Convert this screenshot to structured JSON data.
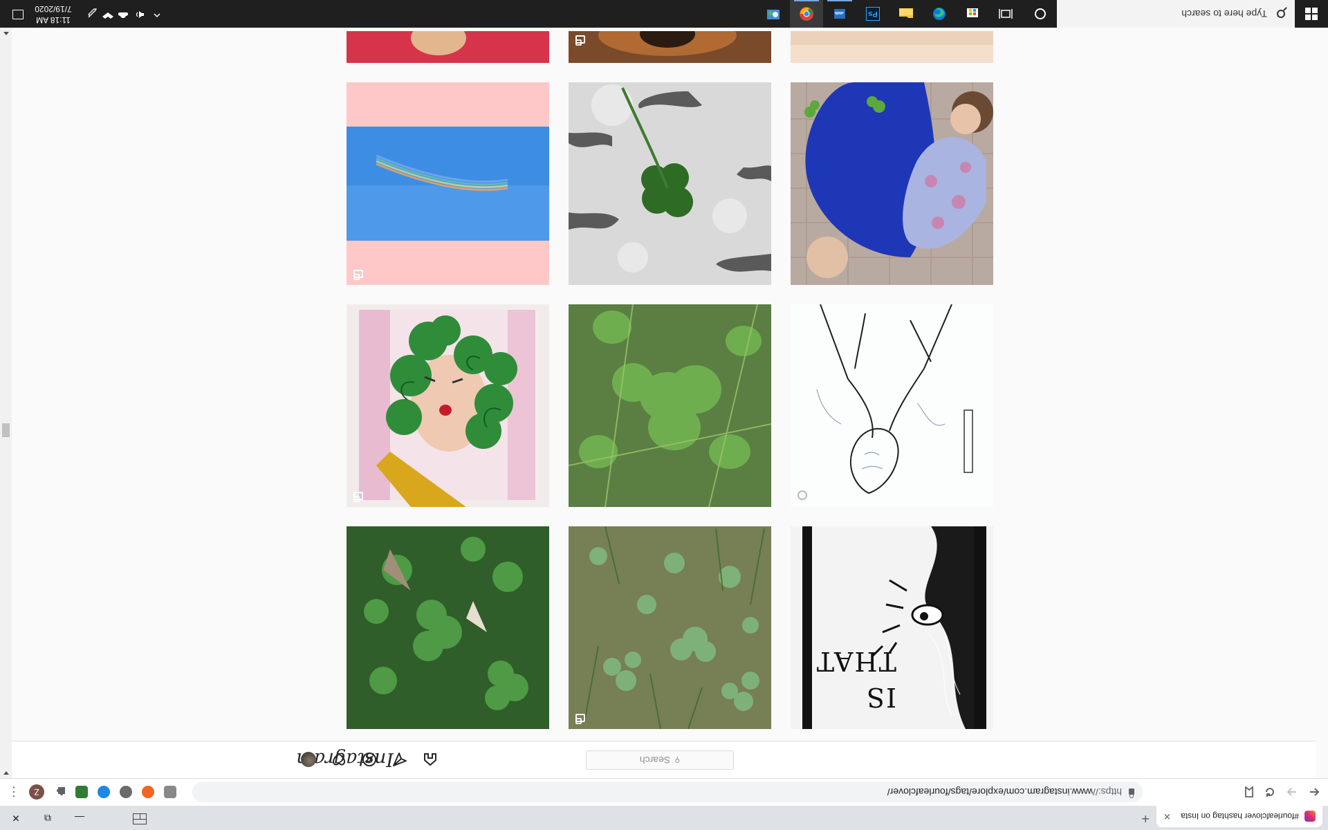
{
  "browser": {
    "tab_title": "#fourleafclover hashtag on Insta",
    "new_tab_label": "+",
    "url_scheme": "https://",
    "url_rest": "www.instagram.com/explore/tags/fourleafclover/",
    "profile_initial": "Z",
    "menu_label": "⋮",
    "close_label": "✕",
    "minimize_label": "—",
    "restore_label": "⧉"
  },
  "instagram": {
    "logo": "Instagram",
    "search_placeholder": "Search",
    "search_icon_glyph": "⚲"
  },
  "taskbar": {
    "search_placeholder": "Type here to search",
    "time": "11:18 AM",
    "date": "7/19/2020",
    "apps": [
      "cortana-icon",
      "task-view-icon",
      "microsoft-store-icon",
      "edge-icon",
      "file-explorer-icon",
      "photoshop-icon",
      "onedrive-icon",
      "chrome-icon",
      "control-panel-icon"
    ],
    "photoshop_label": "Ps"
  },
  "posts": [
    {
      "id": "post-partial-1",
      "badge": "none"
    },
    {
      "id": "post-partial-2",
      "badge": "multi"
    },
    {
      "id": "post-partial-3",
      "badge": "none"
    },
    {
      "id": "post-kids-clover",
      "badge": "none"
    },
    {
      "id": "post-clover-on-concrete",
      "badge": "none"
    },
    {
      "id": "post-rainbow-sky",
      "badge": "multi"
    },
    {
      "id": "post-sketch-portrait",
      "badge": "video"
    },
    {
      "id": "post-clover-leaves",
      "badge": "none"
    },
    {
      "id": "post-green-hair-drawing",
      "badge": "multi"
    },
    {
      "id": "post-comic-panel",
      "badge": "none",
      "comic_text": "IS THAT"
    },
    {
      "id": "post-clover-grass",
      "badge": "multi"
    },
    {
      "id": "post-clover-patch",
      "badge": "none"
    }
  ],
  "colors": {
    "instagram_bg": "#fafafa",
    "taskbar_bg": "#1f1f1f",
    "tab_strip_bg": "#dee1e6"
  }
}
